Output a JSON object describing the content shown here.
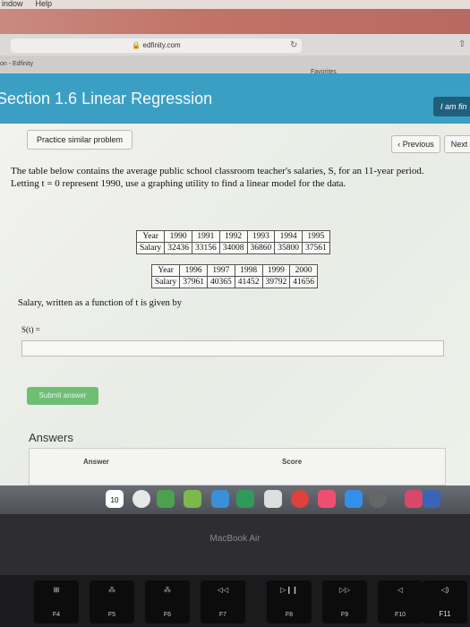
{
  "menubar": {
    "items": [
      "indow",
      "Help"
    ]
  },
  "browser": {
    "url": "edfinity.com",
    "tab": "on - Edfinity",
    "favorites": "Favorites"
  },
  "header": {
    "title": "Section 1.6 Linear Regression",
    "finish": "I am fin"
  },
  "nav": {
    "practice": "Practice similar problem",
    "previous": "‹ Previous",
    "next": "Next"
  },
  "problem": {
    "text": "The table below contains the average public school classroom teacher's salaries, S, for an 11-year period. Letting t = 0 represent 1990, use a graphing utility to find a linear model for the data.",
    "table1": {
      "years": [
        "Year",
        "1990",
        "1991",
        "1992",
        "1993",
        "1994",
        "1995"
      ],
      "salaries": [
        "Salary",
        "32436",
        "33156",
        "34008",
        "36860",
        "35800",
        "37561"
      ]
    },
    "table2": {
      "years": [
        "Year",
        "1996",
        "1997",
        "1998",
        "1999",
        "2000"
      ],
      "salaries": [
        "Salary",
        "37961",
        "40365",
        "41452",
        "39792",
        "41656"
      ]
    },
    "prompt": "Salary, written as a function of t is given by",
    "label": "S(t) =",
    "input_value": ""
  },
  "submit": "Submit answer",
  "answers": {
    "heading": "Answers",
    "col_answer": "Answer",
    "col_score": "Score"
  },
  "dock": {
    "calendar_day": "10"
  },
  "laptop": {
    "model": "MacBook Air",
    "fkeys": [
      "F4",
      "F5",
      "F6",
      "F7",
      "F8",
      "F9",
      "F10",
      "F11"
    ]
  }
}
